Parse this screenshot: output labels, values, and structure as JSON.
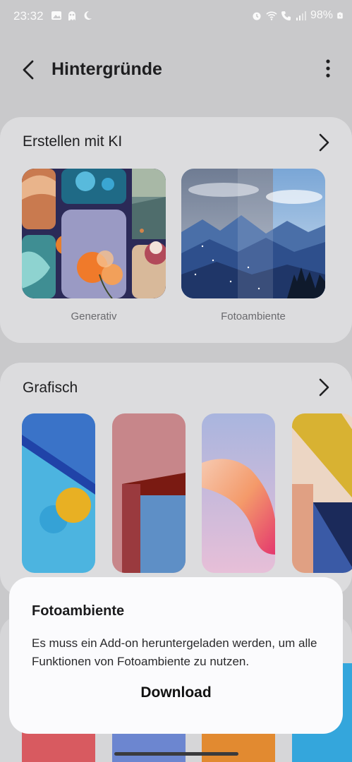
{
  "status": {
    "time": "23:32",
    "battery": "98%",
    "icons_left": [
      "gallery-icon",
      "ghost-icon",
      "moon-icon"
    ],
    "icons_right": [
      "alarm-icon",
      "wifi-icon",
      "wifi-call-icon",
      "signal-icon",
      "battery-icon"
    ]
  },
  "appbar": {
    "title": "Hintergründe"
  },
  "ai_section": {
    "title": "Erstellen mit KI",
    "items": [
      {
        "label": "Generativ"
      },
      {
        "label": "Fotoambiente"
      }
    ]
  },
  "graphic_section": {
    "title": "Grafisch"
  },
  "sheet": {
    "title": "Fotoambiente",
    "body": "Es muss ein Add-on heruntergeladen werden, um alle Funktionen von Fotoambiente zu nutzen.",
    "button": "Download"
  }
}
